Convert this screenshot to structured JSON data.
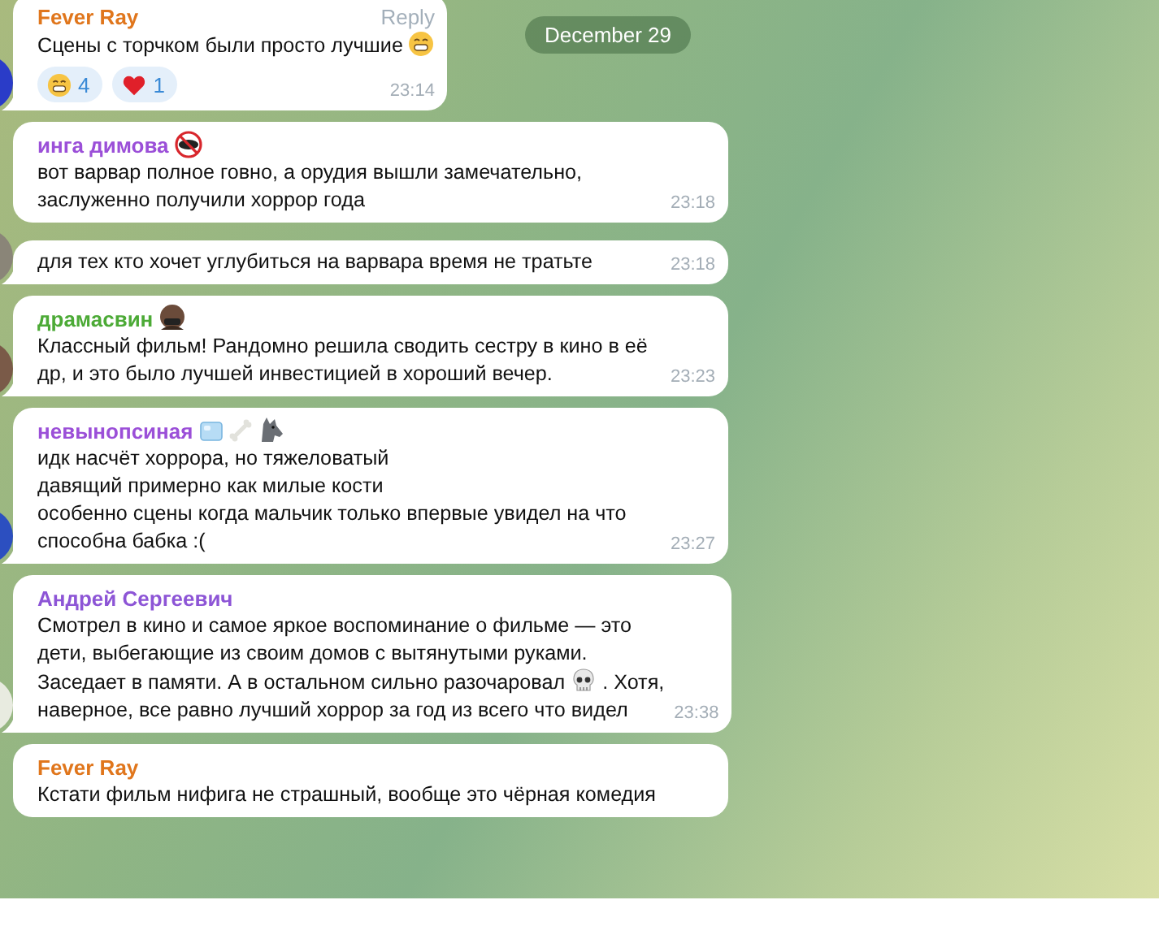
{
  "date_badge": "December 29",
  "messages": [
    {
      "author": "Fever Ray",
      "color": "#e0761c",
      "reply": "Reply",
      "body": [
        {
          "kind": "text",
          "text": "Сцены с торчком были просто лучшие "
        },
        {
          "kind": "grin"
        }
      ],
      "reactions": [
        {
          "kind": "grin",
          "count": "4"
        },
        {
          "kind": "heart",
          "count": "1"
        }
      ],
      "time": "23:14",
      "tail": true
    },
    {
      "author": "инга димова",
      "color": "#9b4fd8",
      "badges": [
        {
          "kind": "no-sign"
        }
      ],
      "body": [
        {
          "kind": "text",
          "text": "вот варвар полное говно, а орудия вышли замечательно,\nзаслуженно получили хоррор года"
        }
      ],
      "time": "23:18",
      "tail": false
    },
    {
      "body": [
        {
          "kind": "text",
          "text": "для тех кто хочет углубиться на варвара время не тратьте"
        }
      ],
      "time": "23:18",
      "tail": true
    },
    {
      "author": "драмасвин",
      "color": "#4caa36",
      "badges": [
        {
          "kind": "hooded-figure"
        }
      ],
      "body": [
        {
          "kind": "text",
          "text": "Классный фильм! Рандомно решила сводить сестру в кино в её\nдр, и это было лучшей инвестицией в хороший вечер."
        }
      ],
      "time": "23:23",
      "tail": true
    },
    {
      "author": "невынопсиная",
      "color": "#9b4fd8",
      "badges": [
        {
          "kind": "ice-cube"
        },
        {
          "kind": "bone"
        },
        {
          "kind": "wolf"
        }
      ],
      "body": [
        {
          "kind": "text",
          "text": "идк насчёт хоррора, но тяжеловатый\nдавящий примерно как милые кости\nособенно сцены когда мальчик только впервые увидел на что\nспособна бабка :("
        }
      ],
      "time": "23:27",
      "tail": true
    },
    {
      "author": "Андрей Сергеевич",
      "color": "#8d55d6",
      "body": [
        {
          "kind": "text",
          "text": "Смотрел в кино и самое яркое воспоминание о фильме — это\nдети, выбегающие из своим домов с вытянутыми руками.\nЗаседает в памяти. А в остальном сильно разочаровал "
        },
        {
          "kind": "skull"
        },
        {
          "kind": "text",
          "text": " . Хотя,\nнаверное, все равно лучший хоррор за год из всего что видел"
        }
      ],
      "time": "23:38",
      "tail": true
    },
    {
      "author": "Fever Ray",
      "color": "#e0761c",
      "body": [
        {
          "kind": "text",
          "text": "Кстати фильм нифига не страшный, вообще это чёрная комедия"
        }
      ],
      "tail": false
    }
  ]
}
